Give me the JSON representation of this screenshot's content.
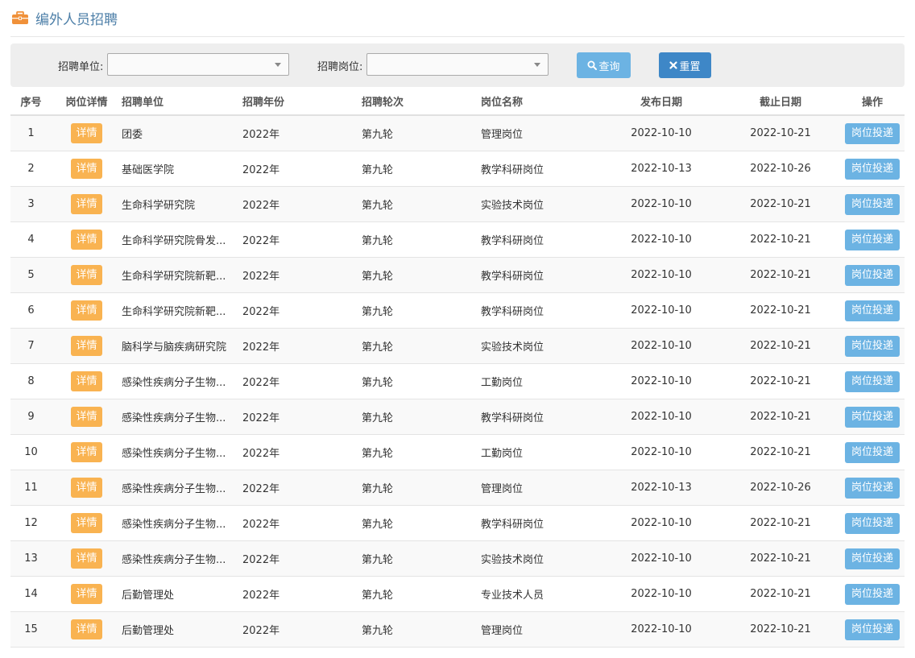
{
  "page": {
    "title": "编外人员招聘",
    "title_icon": "briefcase-icon",
    "accent_color": "#f0913a"
  },
  "filters": {
    "unit_label": "招聘单位:",
    "unit_value": "",
    "position_label": "招聘岗位:",
    "position_value": "",
    "search_label": "查询",
    "search_icon": "search-icon",
    "reset_label": "重置",
    "reset_icon": "close-icon"
  },
  "table": {
    "headers": [
      "序号",
      "岗位详情",
      "招聘单位",
      "招聘年份",
      "招聘轮次",
      "岗位名称",
      "发布日期",
      "截止日期",
      "操作"
    ],
    "detail_label": "详情",
    "action_label": "岗位投递",
    "rows": [
      {
        "no": "1",
        "unit": "团委",
        "year": "2022年",
        "round": "第九轮",
        "position": "管理岗位",
        "publish": "2022-10-10",
        "deadline": "2022-10-21"
      },
      {
        "no": "2",
        "unit": "基础医学院",
        "year": "2022年",
        "round": "第九轮",
        "position": "教学科研岗位",
        "publish": "2022-10-13",
        "deadline": "2022-10-26"
      },
      {
        "no": "3",
        "unit": "生命科学研究院",
        "year": "2022年",
        "round": "第九轮",
        "position": "实验技术岗位",
        "publish": "2022-10-10",
        "deadline": "2022-10-21"
      },
      {
        "no": "4",
        "unit": "生命科学研究院骨发...",
        "year": "2022年",
        "round": "第九轮",
        "position": "教学科研岗位",
        "publish": "2022-10-10",
        "deadline": "2022-10-21"
      },
      {
        "no": "5",
        "unit": "生命科学研究院新靶...",
        "year": "2022年",
        "round": "第九轮",
        "position": "教学科研岗位",
        "publish": "2022-10-10",
        "deadline": "2022-10-21"
      },
      {
        "no": "6",
        "unit": "生命科学研究院新靶...",
        "year": "2022年",
        "round": "第九轮",
        "position": "教学科研岗位",
        "publish": "2022-10-10",
        "deadline": "2022-10-21"
      },
      {
        "no": "7",
        "unit": "脑科学与脑疾病研究院",
        "year": "2022年",
        "round": "第九轮",
        "position": "实验技术岗位",
        "publish": "2022-10-10",
        "deadline": "2022-10-21"
      },
      {
        "no": "8",
        "unit": "感染性疾病分子生物...",
        "year": "2022年",
        "round": "第九轮",
        "position": "工勤岗位",
        "publish": "2022-10-10",
        "deadline": "2022-10-21"
      },
      {
        "no": "9",
        "unit": "感染性疾病分子生物...",
        "year": "2022年",
        "round": "第九轮",
        "position": "教学科研岗位",
        "publish": "2022-10-10",
        "deadline": "2022-10-21"
      },
      {
        "no": "10",
        "unit": "感染性疾病分子生物...",
        "year": "2022年",
        "round": "第九轮",
        "position": "工勤岗位",
        "publish": "2022-10-10",
        "deadline": "2022-10-21"
      },
      {
        "no": "11",
        "unit": "感染性疾病分子生物...",
        "year": "2022年",
        "round": "第九轮",
        "position": "管理岗位",
        "publish": "2022-10-13",
        "deadline": "2022-10-26"
      },
      {
        "no": "12",
        "unit": "感染性疾病分子生物...",
        "year": "2022年",
        "round": "第九轮",
        "position": "教学科研岗位",
        "publish": "2022-10-10",
        "deadline": "2022-10-21"
      },
      {
        "no": "13",
        "unit": "感染性疾病分子生物...",
        "year": "2022年",
        "round": "第九轮",
        "position": "实验技术岗位",
        "publish": "2022-10-10",
        "deadline": "2022-10-21"
      },
      {
        "no": "14",
        "unit": "后勤管理处",
        "year": "2022年",
        "round": "第九轮",
        "position": "专业技术人员",
        "publish": "2022-10-10",
        "deadline": "2022-10-21"
      },
      {
        "no": "15",
        "unit": "后勤管理处",
        "year": "2022年",
        "round": "第九轮",
        "position": "管理岗位",
        "publish": "2022-10-10",
        "deadline": "2022-10-21"
      }
    ]
  }
}
